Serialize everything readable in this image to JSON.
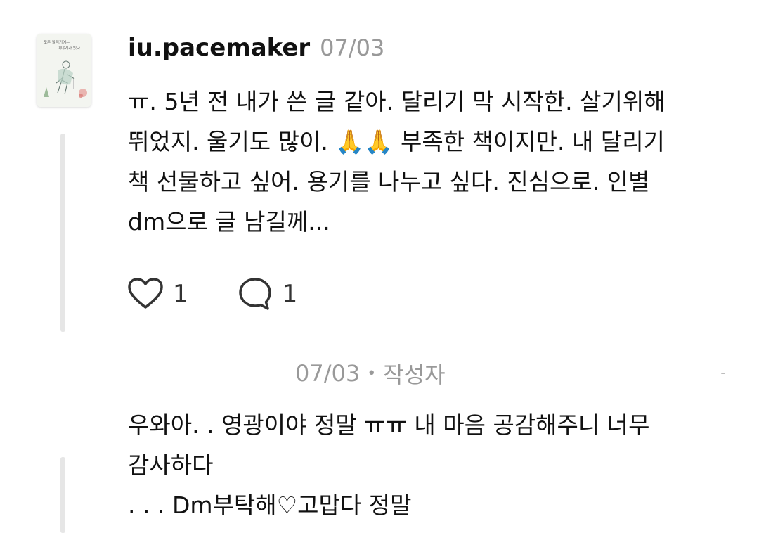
{
  "comment": {
    "avatar": {
      "title_line1": "모든 달리기에는",
      "title_line2": "이야기가 있다"
    },
    "username": "iu.pacemaker",
    "date": "07/03",
    "body_lines": [
      "ㅠ. 5년 전 내가 쓴 글 같아. 달리기 막 시작한. 살기위해",
      "뛰었지. 울기도 많이. 🙏🙏 부족한 책이지만. 내 달리기",
      "책 선물하고 싶어. 용기를 나누고 싶다. 진심으로. 인별",
      "dm으로 글 남길께..."
    ],
    "actions": {
      "like_icon": "heart-outline-icon",
      "like_count": "1",
      "reply_icon": "speech-bubble-icon",
      "reply_count": "1"
    }
  },
  "reply": {
    "date": "07/03",
    "separator": "•",
    "author_badge": "작성자",
    "body_lines": [
      "우와아. .  영광이야 정말 ㅠㅠ 내 마음 공감해주니 너무",
      "감사하다",
      ". . .  Dm부탁해♡고맙다 정말"
    ]
  },
  "colors": {
    "text_primary": "#111111",
    "text_muted": "#999999",
    "thread_line": "#e6e6e6",
    "icon_stroke": "#333333"
  }
}
